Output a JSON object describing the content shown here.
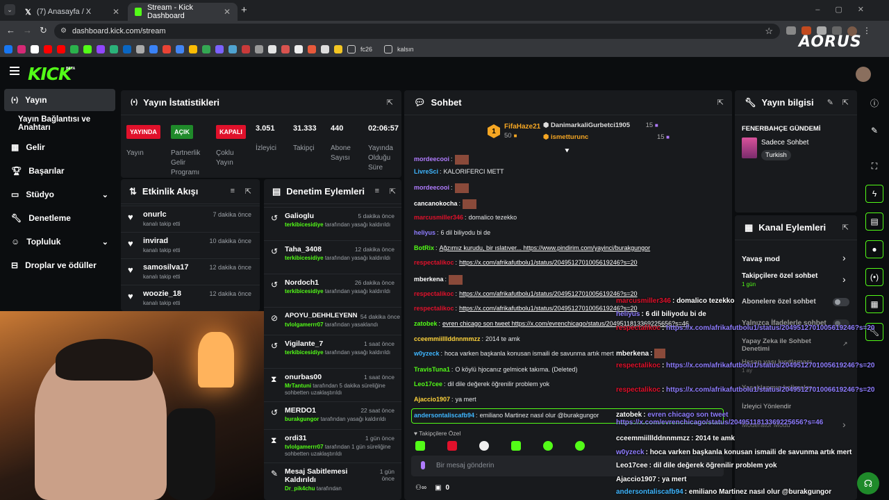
{
  "browser": {
    "tabs": [
      {
        "label": "(7) Anasayfa / X"
      },
      {
        "label": "Stream - Kick Dashboard"
      }
    ],
    "url": "dashboard.kick.com/stream",
    "bookmarks": [
      "fc26",
      "kalsın"
    ],
    "overlay_logo": "AORUS"
  },
  "brand": {
    "logo": "KICK",
    "beta": "BETA",
    "accent": "#53fc18"
  },
  "sidebar": {
    "items": [
      {
        "label": "Yayın",
        "icon": "broadcast-icon"
      },
      {
        "label": "Yayın Bağlantısı ve Anahtarı",
        "icon": ""
      },
      {
        "label": "Gelir",
        "icon": "chart-icon"
      },
      {
        "label": "Başarılar",
        "icon": "trophy-icon"
      },
      {
        "label": "Stüdyo",
        "icon": "studio-icon"
      },
      {
        "label": "Denetleme",
        "icon": "wrench-icon"
      },
      {
        "label": "Topluluk",
        "icon": "community-icon"
      },
      {
        "label": "Droplar ve ödüller",
        "icon": "drops-icon"
      }
    ]
  },
  "stats": {
    "title": "Yayın İstatistikleri",
    "items": [
      {
        "badge": "YAYINDA",
        "badge_color": "#e0112b",
        "label": "Yayın"
      },
      {
        "badge": "AÇIK",
        "badge_color": "#1f8a2a",
        "label": "Partnerlik Gelir Programı"
      },
      {
        "badge": "KAPALI",
        "badge_color": "#e0112b",
        "label": "Çoklu Yayın"
      },
      {
        "value": "3.051",
        "label": "İzleyici"
      },
      {
        "value": "31.333",
        "label": "Takipçi"
      },
      {
        "value": "440",
        "label": "Abone Sayısı"
      },
      {
        "value": "02:06:57",
        "label": "Yayında Olduğu Süre"
      }
    ]
  },
  "activity": {
    "title": "Etkinlik Akışı",
    "rows": [
      {
        "name": "onurlc",
        "sub": "kanalı takip etti",
        "time": "7 dakika önce"
      },
      {
        "name": "invirad",
        "sub": "kanalı takip etti",
        "time": "10 dakika önce"
      },
      {
        "name": "samosilva17",
        "sub": "kanalı takip etti",
        "time": "12 dakika önce"
      },
      {
        "name": "woozie_18",
        "sub": "kanalı takip etti",
        "time": "12 dakika önce"
      }
    ]
  },
  "moderation": {
    "title": "Denetim Eylemleri",
    "rows": [
      {
        "name": "Galioglu",
        "mod": "terkibicesidiye",
        "text": " tarafından yasağı kaldırıldı",
        "time": "5 dakika önce"
      },
      {
        "name": "Taha_3408",
        "mod": "terkibicesidiye",
        "text": " tarafından yasağı kaldırıldı",
        "time": "12 dakika önce"
      },
      {
        "name": "Nordoch1",
        "mod": "terkibicesidiye",
        "text": " tarafından yasağı kaldırıldı",
        "time": "26 dakika önce"
      },
      {
        "name": "APOYU_DEHHLEYENN",
        "mod": "tvlolgamerrr07",
        "text": " tarafından yasaklandı",
        "time": "54 dakika önce"
      },
      {
        "name": "Vigilante_7",
        "mod": "terkibicesidiye",
        "text": " tarafından yasağı kaldırıldı",
        "time": "1 saat önce"
      },
      {
        "name": "onurbas00",
        "mod": "MrTantuni",
        "text": " tarafından 5 dakika süreliğine sohbetten uzaklaştırıldı",
        "time": "1 saat önce"
      },
      {
        "name": "MERDO1",
        "mod": "burakgungor",
        "text": " tarafından yasağı kaldırıldı",
        "time": "22 saat önce"
      },
      {
        "name": "ordi31",
        "mod": "tvlolgamerrr07",
        "text": " tarafından 1 gün süreliğine sohbetten uzaklaştırıldı",
        "time": "1 gün önce"
      },
      {
        "name": "Mesaj Sabitlemesi Kaldırıldı",
        "mod": "Dr_pik4chu",
        "text": " tarafından",
        "time": "1 gün önce"
      }
    ]
  },
  "chat": {
    "title": "Sohbet",
    "top": [
      {
        "rank": "1",
        "name": "FifaHaze21",
        "value": "50"
      },
      {
        "name": "DanimarkaliGurbetci1905",
        "value": "15"
      },
      {
        "name": "ismetturunc",
        "value": "15"
      }
    ],
    "messages": [
      {
        "user": "mordeecooi",
        "color": "#b07cff",
        "text": ""
      },
      {
        "user": "LivreSci",
        "color": "#3fb6ff",
        "text": "KALORIFERCI METT"
      },
      {
        "user": "mordeecooi",
        "color": "#b07cff",
        "text": ""
      },
      {
        "user": "cancanokocha",
        "color": "#ffffff",
        "text": ""
      },
      {
        "user": "marcusmiller346",
        "color": "#e0112b",
        "text": "domalico tezekko"
      },
      {
        "user": "heliyus",
        "color": "#8f7dff",
        "text": "6 dil biliyodu bi de"
      },
      {
        "user": "BotRix",
        "color": "#53fc18",
        "text": "Ağzımız kurudu, bir ıslatıver... https://www.pindirim.com/yayinci/burakgungor"
      },
      {
        "user": "respectalikoc",
        "color": "#e0112b",
        "text": "https://x.com/afrikafutbolu1/status/2049512701005619246?s=20"
      },
      {
        "user": "mberkena",
        "color": "#ffffff",
        "text": ""
      },
      {
        "user": "respectalikoc",
        "color": "#e0112b",
        "text": "https://x.com/afrikafutbolu1/status/2049512701005619246?s=20"
      },
      {
        "user": "respectalikoc",
        "color": "#e0112b",
        "text": "https://x.com/afrikafutbolu1/status/2049512701005619246?s=20"
      },
      {
        "user": "zatobek",
        "color": "#53fc18",
        "text": "evren chicago son tweet https://x.com/evrenchicago/status/2049511813369225656?s=46"
      },
      {
        "user": "cceemmiilllddnnmmzz",
        "color": "#ffd43b",
        "text": "2014 te amk"
      },
      {
        "user": "w0yzeck",
        "color": "#3fb6ff",
        "text": "hoca varken başkanla konusan ismaili de savunma artık mert"
      },
      {
        "user": "TravisTuna1",
        "color": "#53fc18",
        "text": "O köylü hjocanız gelmicek takıma. (Deleted)"
      },
      {
        "user": "Leo17cee",
        "color": "#53fc18",
        "text": "dil dile değerek öğrenilir problem yok"
      },
      {
        "user": "Ajaccio1907",
        "color": "#ffd43b",
        "text": "ya mert"
      },
      {
        "user": "andersontaliscafb94",
        "color": "#3fb6ff",
        "text": "emiliano Martinez nasıl olur @burakgungor"
      }
    ],
    "followers_only": "Takipçilere Özel",
    "input_placeholder": "Bir mesaj gönderin",
    "counter": "0"
  },
  "overlay_chat": [
    {
      "user": "marcusmiller346",
      "color": "#e0112b",
      "text": "domalico tezekko"
    },
    {
      "user": "heliyus",
      "color": "#8f7dff",
      "text": "6 dil biliyodu bi de"
    },
    {
      "user": "respectalikoc",
      "color": "#e0112b",
      "text": "https://x.com/afrikafutbolu1/status/2049512701005619246?s=20"
    },
    {
      "user": "mberkena",
      "color": "#ffffff",
      "text": ""
    },
    {
      "user": "respectalikoc",
      "color": "#e0112b",
      "text": "https://x.com/afrikafutbolu1/status/2049512701005619246?s=20"
    },
    {
      "user": "respectalikoc",
      "color": "#e0112b",
      "text": "https://x.com/afrikafutbolu1/status/2049512701006619246?s=20"
    },
    {
      "user": "zatobek",
      "color": "#ffffff",
      "text": "evren chicago son tweet https://x.com/evrenchicago/status/2049511813369225656?s=46"
    },
    {
      "user": "cceemmiilllddnnmmzz",
      "color": "#ffffff",
      "text": "2014 te amk"
    },
    {
      "user": "w0yzeck",
      "color": "#8f7dff",
      "text": "hoca varken başkanla konusan ismaili de savunma artık mert"
    },
    {
      "user": "Leo17cee",
      "color": "#ffffff",
      "text": "dil dile değerek öğrenilir problem yok"
    },
    {
      "user": "Ajaccio1907",
      "color": "#ffffff",
      "text": "ya mert"
    },
    {
      "user": "andersontaliscafb94",
      "color": "#3fb6ff",
      "text": "emiliano Martinez nasıl olur @burakgungor"
    }
  ],
  "stream_info": {
    "title": "Yayın bilgisi",
    "stream_title": "FENERBAHÇE GÜNDEMİ",
    "category": "Sadece Sohbet",
    "language": "Turkish"
  },
  "channel_actions": {
    "title": "Kanal Eylemleri",
    "items": [
      {
        "label": "Yavaş mod",
        "sub": ""
      },
      {
        "label": "Takipçilere özel sohbet",
        "sub": "1 gün"
      },
      {
        "label": "Abonelere özel sohbet",
        "sub": ""
      },
      {
        "label": "Yalnızca İfadelerle sohbet",
        "sub": ""
      },
      {
        "label": "Yapay Zeka ile Sohbet Denetimi",
        "sub": ""
      },
      {
        "label": "Hesap yaşı kısıtlaması",
        "sub": "1 ay"
      },
      {
        "label": "Yasaklanmış kelimeler",
        "sub": ""
      },
      {
        "label": "İzleyici Yönlendir",
        "sub": ""
      },
      {
        "label": "Moderatör Modu",
        "sub": ""
      }
    ]
  }
}
